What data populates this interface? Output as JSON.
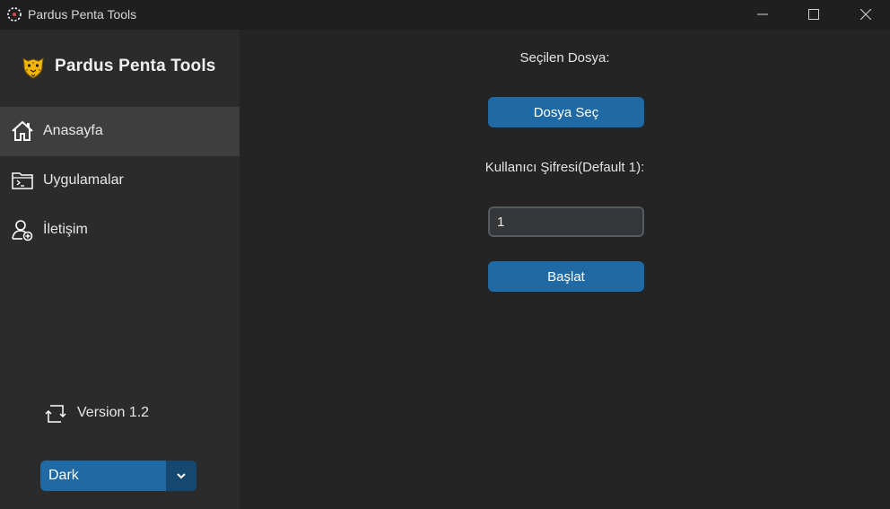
{
  "window": {
    "title": "Pardus Penta Tools"
  },
  "sidebar": {
    "app_name": "Pardus Penta Tools",
    "items": [
      {
        "label": "Anasayfa",
        "icon": "home-icon",
        "active": true
      },
      {
        "label": "Uygulamalar",
        "icon": "terminal-folder-icon",
        "active": false
      },
      {
        "label": "İletişim",
        "icon": "user-add-icon",
        "active": false
      }
    ],
    "version_label": "Version 1.2",
    "theme_value": "Dark"
  },
  "main": {
    "selected_file_label": "Seçilen Dosya:",
    "choose_file_button": "Dosya Seç",
    "password_label": "Kullanıcı Şifresi(Default 1):",
    "password_value": "1",
    "start_button": "Başlat"
  },
  "colors": {
    "accent": "#1f6aa5",
    "accent_dark": "#144870",
    "sidebar_bg": "#2b2b2b",
    "main_bg": "#242424",
    "active_item_bg": "#3e3e3e"
  }
}
